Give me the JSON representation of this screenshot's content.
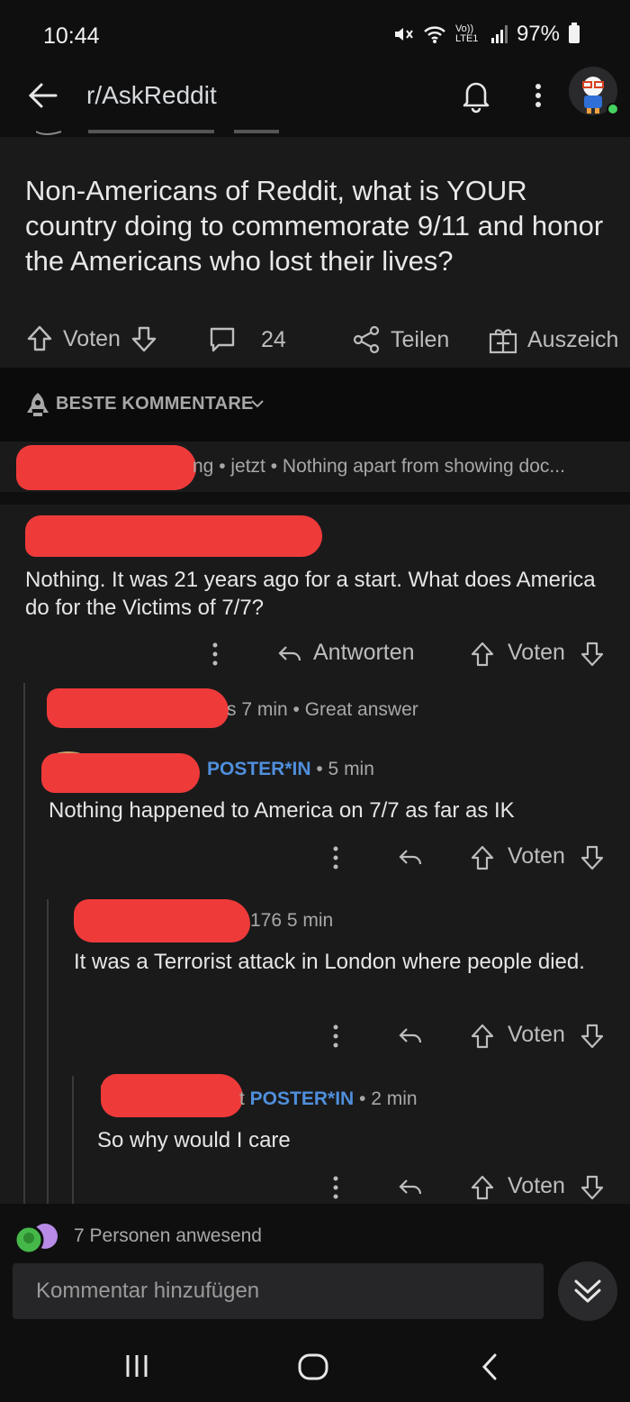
{
  "status_bar": {
    "time": "10:44",
    "battery": "97%",
    "network": "Vo)) LTE1"
  },
  "header": {
    "subreddit": "r/AskReddit"
  },
  "post": {
    "title": "Non-Americans of Reddit, what is YOUR country doing to commemorate 9/11 and honor the Americans who lost their lives?",
    "vote_label": "Voten",
    "comment_count": "24",
    "share_label": "Teilen",
    "award_label": "Auszeich"
  },
  "sort": {
    "label": "BESTE KOMMENTARE"
  },
  "collapsed_comment": {
    "meta": "ng • jetzt • Nothing apart from showing doc..."
  },
  "comments": [
    {
      "body": "Nothing. It was 21 years ago for a start. What does America do for the Victims of 7/7?",
      "reply_label": "Antworten",
      "vote_label": "Voten"
    },
    {
      "meta": "s 7 min • Great answer"
    },
    {
      "op_tag": "POSTER*IN",
      "time": " • 5 min",
      "body": "Nothing happened to America on 7/7 as far as IK",
      "vote_label": "Voten"
    },
    {
      "meta": "176 5 min",
      "body": "It was a Terrorist attack in London where people died.",
      "vote_label": "Voten"
    },
    {
      "prefix": "t ",
      "op_tag": "POSTER*IN",
      "time": " • 2 min",
      "body": "So why would I care",
      "vote_label": "Voten"
    }
  ],
  "presence": {
    "text": "7 Personen anwesend"
  },
  "composer": {
    "placeholder": "Kommentar hinzufügen"
  },
  "colors": {
    "accent_op": "#4f8fdc",
    "redaction": "#ef3a3a",
    "online": "#46d160"
  }
}
